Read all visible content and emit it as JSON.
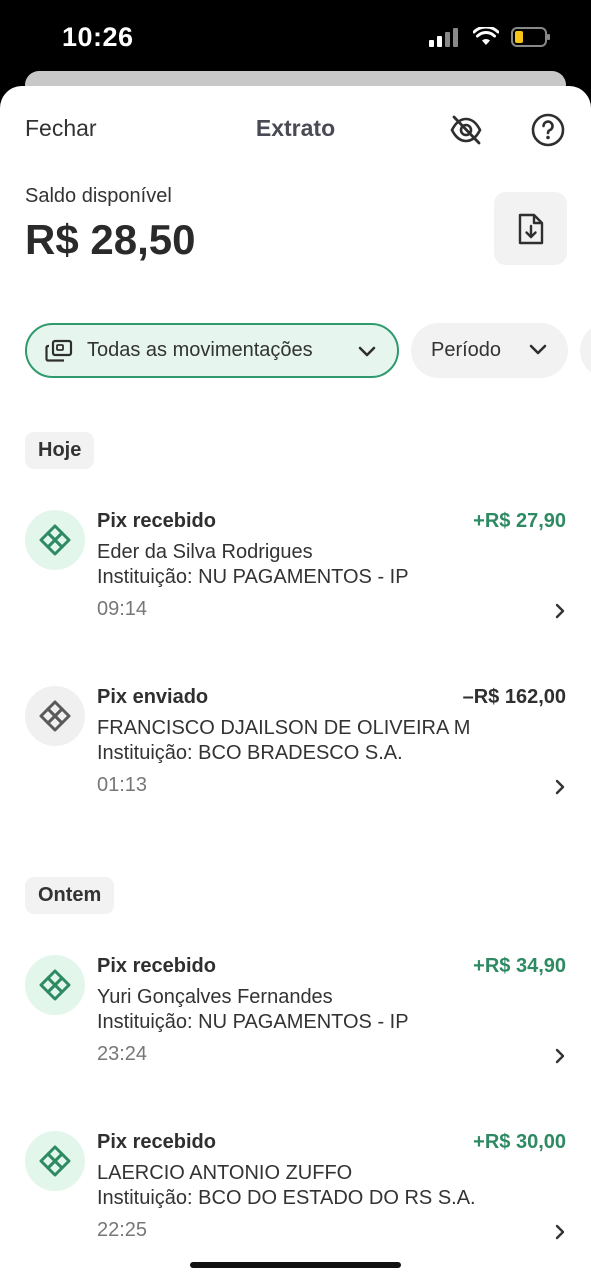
{
  "status_bar": {
    "time": "10:26",
    "icons": [
      "signal-icon",
      "wifi-icon",
      "battery-icon"
    ]
  },
  "header": {
    "close_label": "Fechar",
    "title": "Extrato",
    "icons": [
      "eye-off-icon",
      "help-icon"
    ]
  },
  "balance": {
    "label": "Saldo disponível",
    "value": "R$ 28,50",
    "download_icon": "file-download-icon"
  },
  "filters": {
    "all": {
      "label": "Todas as movimentações",
      "icon": "cards-icon"
    },
    "period": {
      "label": "Período"
    }
  },
  "colors": {
    "accent": "#2f9a6e",
    "positive_amount": "#2e8a62",
    "chip_selected_bg": "#e6f6ee",
    "icon_in_bg": "#e3f6ec",
    "icon_out_bg": "#f0f0f0"
  },
  "sections": [
    {
      "label": "Hoje",
      "transactions": [
        {
          "type": "Pix recebido",
          "amount": "+R$ 27,90",
          "name": "Eder da Silva Rodrigues",
          "institution": "Instituição: NU PAGAMENTOS - IP",
          "time": "09:14",
          "direction": "in"
        },
        {
          "type": "Pix enviado",
          "amount": "–R$ 162,00",
          "name": "FRANCISCO DJAILSON DE OLIVEIRA M",
          "institution": "Instituição: BCO BRADESCO S.A.",
          "time": "01:13",
          "direction": "out"
        }
      ]
    },
    {
      "label": "Ontem",
      "transactions": [
        {
          "type": "Pix recebido",
          "amount": "+R$ 34,90",
          "name": "Yuri Gonçalves Fernandes",
          "institution": "Instituição: NU PAGAMENTOS - IP",
          "time": "23:24",
          "direction": "in"
        },
        {
          "type": "Pix recebido",
          "amount": "+R$ 30,00",
          "name": "LAERCIO ANTONIO ZUFFO",
          "institution": "Instituição: BCO DO ESTADO DO RS S.A.",
          "time": "22:25",
          "direction": "in"
        }
      ]
    }
  ]
}
